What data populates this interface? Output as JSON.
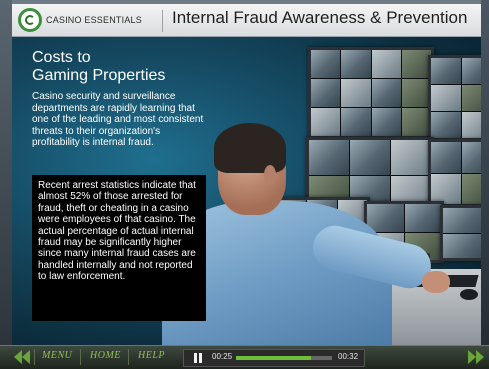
{
  "header": {
    "logo_text": "CASINO ESSENTIALS",
    "title": "Internal Fraud Awareness & Prevention"
  },
  "slide": {
    "title_line1": "Costs to",
    "title_line2": "Gaming Properties",
    "intro": "Casino security and surveillance departments are rapidly learning that one of the leading and most consistent threats to their organization's profitability is internal fraud.",
    "callout": "Recent arrest statistics indicate that almost 52% of those arrested for fraud, theft or cheating in a casino were employees of that casino.  The actual percentage of actual internal fraud may be significantly higher since many internal fraud cases are handled internally and not reported to law enforcement."
  },
  "nav": {
    "menu": "MENU",
    "home": "HOME",
    "help": "HELP"
  },
  "player": {
    "current_time": "00:25",
    "total_time": "00:32",
    "progress": 0.78
  },
  "colors": {
    "accent_green": "#6fbf3a",
    "nav_text": "#8fbf5a"
  },
  "icons": {
    "back": "back-arrow-icon",
    "forward": "forward-arrow-icon",
    "pause": "pause-icon",
    "logo": "casino-essentials-logo"
  }
}
